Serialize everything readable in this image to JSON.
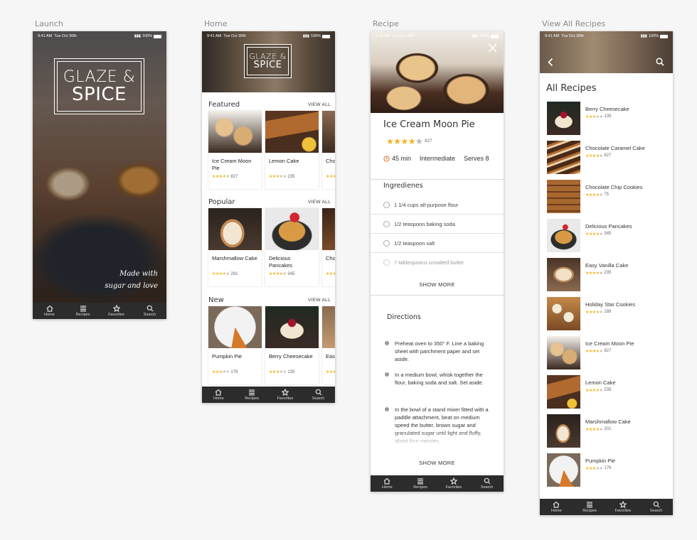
{
  "artboards": {
    "launch": "Launch",
    "home": "Home",
    "recipe": "Recipe",
    "all": "View All Recipes"
  },
  "status": {
    "time": "9:41 AM",
    "date": "Tue Oct 30th",
    "battery": "100%"
  },
  "tabs": [
    "Home",
    "Recipes",
    "Favorites",
    "Search"
  ],
  "logo": {
    "top": "GLAZE &",
    "bottom": "SPICE"
  },
  "launch": {
    "tagline_1": "Made with",
    "tagline_2": "sugar and love"
  },
  "home": {
    "view_all": "VIEW ALL",
    "sections": [
      {
        "title": "Featured",
        "cards": [
          {
            "name": "Ice Cream Moon Pie",
            "stars": 4,
            "count": "827"
          },
          {
            "name": "Lemon Cake",
            "stars": 3,
            "count": "235"
          },
          {
            "name": "Cho Coo",
            "stars": 4,
            "count": ""
          }
        ]
      },
      {
        "title": "Popular",
        "cards": [
          {
            "name": "Marshmallow Cake",
            "stars": 4,
            "count": "281"
          },
          {
            "name": "Delicious Pancakes",
            "stars": 4,
            "count": "345"
          },
          {
            "name": "Cho Car",
            "stars": 4,
            "count": ""
          }
        ]
      },
      {
        "title": "New",
        "cards": [
          {
            "name": "Pumpkin Pie",
            "stars": 3,
            "count": "176"
          },
          {
            "name": "Berry Cheesecake",
            "stars": 3,
            "count": "135"
          },
          {
            "name": "Eas Cak",
            "stars": 4,
            "count": ""
          }
        ]
      }
    ]
  },
  "recipe": {
    "title": "Ice Cream Moon Pie",
    "stars": 4,
    "count": "827",
    "time": "45 min",
    "difficulty": "Intermediate",
    "serves": "Serves 8",
    "ingredients_title": "Ingredienes",
    "ingredients": [
      "1 1/4 cups all-purpose flour",
      "1/2 teaspoon baking soda",
      "1/2 teaspoon salt",
      "7 tablespoons unsalted butter"
    ],
    "show_more": "SHOW MORE",
    "directions_title": "Directions",
    "directions": [
      "Preheat oven to 350° F. Line a baking sheet with parchment paper and set aside.",
      "In a medium bowl, whisk together the flour, baking soda and salt. Set aside.",
      "In the bowl of a stand mixer fitted with a paddle attachment, beat on medium speed the butter, brown sugar and granulated sugar until light and fluffy, about four minutes."
    ]
  },
  "all_recipes": {
    "title": "All Recipes",
    "items": [
      {
        "name": "Berry Cheesecake",
        "stars": 3,
        "count": "135"
      },
      {
        "name": "Chocolate Caramel Cake",
        "stars": 4,
        "count": "827"
      },
      {
        "name": "Chocolate Chip Cookies",
        "stars": 4,
        "count": "75"
      },
      {
        "name": "Delicious Pancakes",
        "stars": 4,
        "count": "345"
      },
      {
        "name": "Easy Vanilla Cake",
        "stars": 4,
        "count": "235"
      },
      {
        "name": "Holiday Star Cookies",
        "stars": 4,
        "count": "188"
      },
      {
        "name": "Ice Cream Moon Pie",
        "stars": 4,
        "count": "827"
      },
      {
        "name": "Lemon Cake",
        "stars": 4,
        "count": "235"
      },
      {
        "name": "Marshmallow Cake",
        "stars": 4,
        "count": "201"
      },
      {
        "name": "Pumpkin Pie",
        "stars": 3,
        "count": "176"
      }
    ]
  },
  "colors": {
    "star": "#f5b31b",
    "tabbar": "#2c2c2c"
  },
  "icons": {
    "tabs": [
      "home-icon",
      "recipes-icon",
      "favorites-icon",
      "search-icon"
    ]
  }
}
